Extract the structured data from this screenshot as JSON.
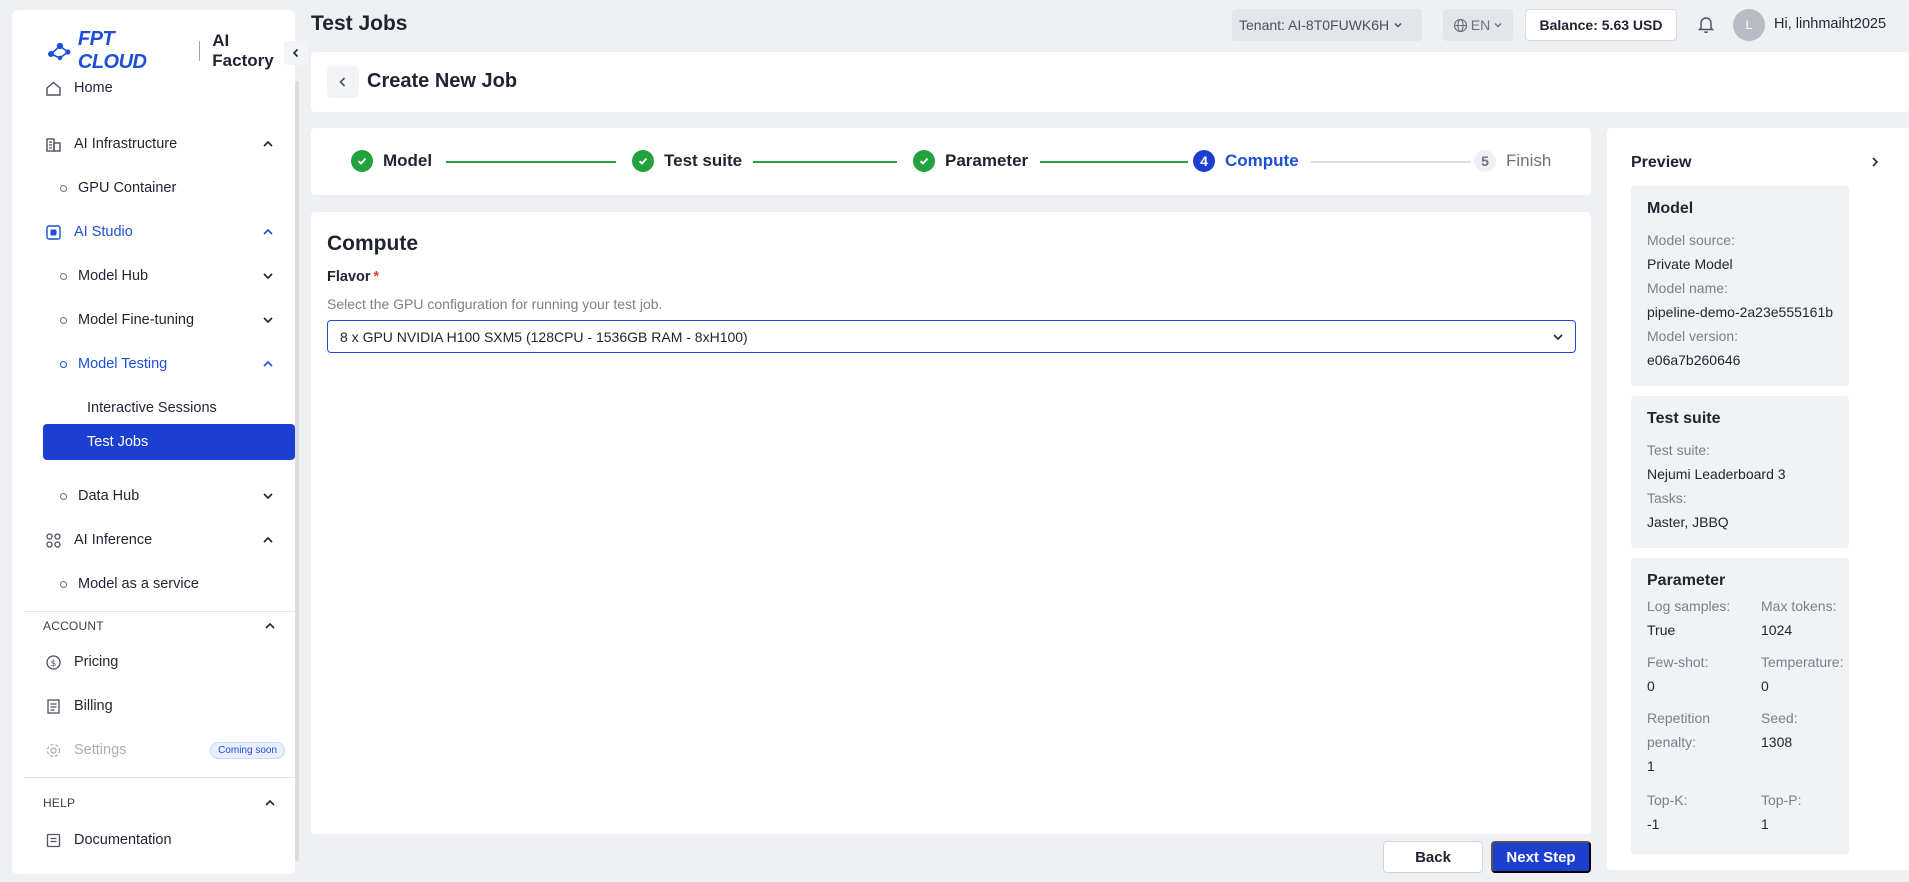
{
  "brand": {
    "logo_text": "FPT CLOUD",
    "product": "AI Factory"
  },
  "header": {
    "page_title": "Test Jobs",
    "tenant": "Tenant: AI-8T0FUWK6H",
    "language": "EN",
    "balance": "Balance: 5.63 USD",
    "avatar_initial": "L",
    "greeting": "Hi, linhmaiht2025"
  },
  "sidebar": {
    "home": "Home",
    "ai_infrastructure": "AI Infrastructure",
    "gpu_container": "GPU Container",
    "ai_studio": "AI Studio",
    "model_hub": "Model Hub",
    "model_fine_tuning": "Model Fine-tuning",
    "model_testing": "Model Testing",
    "interactive_sessions": "Interactive Sessions",
    "test_jobs": "Test Jobs",
    "data_hub": "Data Hub",
    "ai_inference": "AI Inference",
    "model_as_a_service": "Model as a service",
    "account_section": "ACCOUNT",
    "pricing": "Pricing",
    "billing": "Billing",
    "settings": "Settings",
    "coming_soon": "Coming soon",
    "help_section": "HELP",
    "documentation": "Documentation"
  },
  "page": {
    "title": "Create New Job"
  },
  "stepper": {
    "steps": [
      {
        "label": "Model",
        "status": "done"
      },
      {
        "label": "Test suite",
        "status": "done"
      },
      {
        "label": "Parameter",
        "status": "done"
      },
      {
        "number": "4",
        "label": "Compute",
        "status": "active"
      },
      {
        "number": "5",
        "label": "Finish",
        "status": "pending"
      }
    ]
  },
  "compute": {
    "title": "Compute",
    "flavor_label": "Flavor",
    "required_mark": "*",
    "flavor_help": "Select the GPU configuration for running your test job.",
    "flavor_value": "8 x GPU NVIDIA H100 SXM5 (128CPU - 1536GB RAM - 8xH100)"
  },
  "footer": {
    "back": "Back",
    "next": "Next Step"
  },
  "preview": {
    "title": "Preview",
    "model": {
      "heading": "Model",
      "source_label": "Model source:",
      "source_value": "Private Model",
      "name_label": "Model name:",
      "name_value": "pipeline-demo-2a23e555161b",
      "version_label": "Model version:",
      "version_value": "e06a7b260646"
    },
    "test_suite": {
      "heading": "Test suite",
      "suite_label": "Test suite:",
      "suite_value": "Nejumi Leaderboard 3",
      "tasks_label": "Tasks:",
      "tasks_value": "Jaster, JBBQ"
    },
    "parameter": {
      "heading": "Parameter",
      "log_samples_label": "Log samples:",
      "log_samples_value": "True",
      "max_tokens_label": "Max tokens:",
      "max_tokens_value": "1024",
      "few_shot_label": "Few-shot:",
      "few_shot_value": "0",
      "temperature_label": "Temperature:",
      "temperature_value": "0",
      "repetition_label_1": "Repetition",
      "repetition_label_2": "penalty:",
      "repetition_value": "1",
      "seed_label": "Seed:",
      "seed_value": "1308",
      "top_k_label": "Top-K:",
      "top_k_value": "-1",
      "top_p_label": "Top-P:",
      "top_p_value": "1"
    }
  },
  "colors": {
    "primary": "#1d3fd0",
    "success": "#22a13d",
    "required": "#e03e3e"
  }
}
